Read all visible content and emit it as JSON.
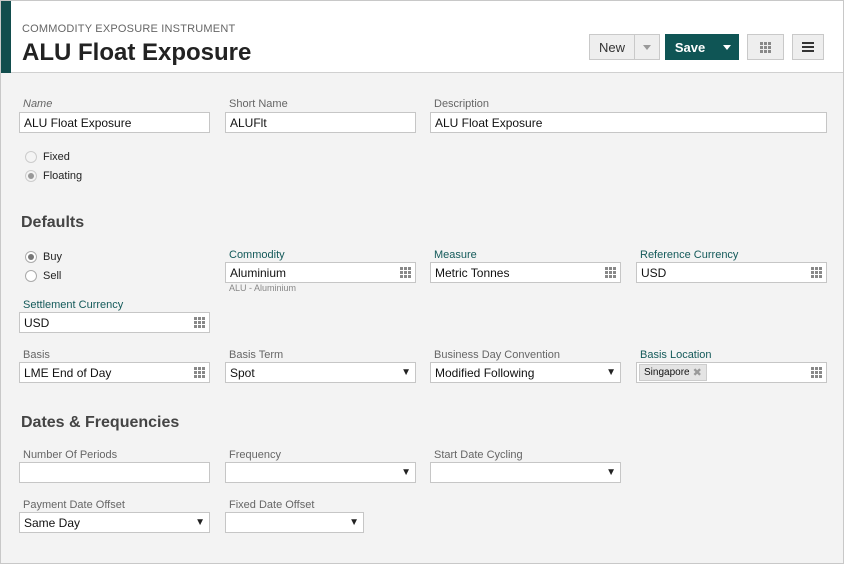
{
  "header": {
    "kicker": "COMMODITY EXPOSURE INSTRUMENT",
    "title": "ALU Float Exposure",
    "new_label": "New",
    "save_label": "Save"
  },
  "general": {
    "name_label": "Name",
    "name_value": "ALU Float Exposure",
    "short_name_label": "Short Name",
    "short_name_value": "ALUFlt",
    "description_label": "Description",
    "description_value": "ALU Float Exposure",
    "rate_type": {
      "options": [
        "Fixed",
        "Floating"
      ],
      "selected": "Floating"
    }
  },
  "defaults": {
    "title": "Defaults",
    "direction": {
      "options": [
        "Buy",
        "Sell"
      ],
      "selected": "Buy"
    },
    "commodity_label": "Commodity",
    "commodity_value": "Aluminium",
    "commodity_hint": "ALU - Aluminium",
    "measure_label": "Measure",
    "measure_value": "Metric Tonnes",
    "reference_currency_label": "Reference Currency",
    "reference_currency_value": "USD",
    "settlement_currency_label": "Settlement Currency",
    "settlement_currency_value": "USD",
    "basis_label": "Basis",
    "basis_value": "LME End of Day",
    "basis_term_label": "Basis Term",
    "basis_term_value": "Spot",
    "business_day_label": "Business Day Convention",
    "business_day_value": "Modified Following",
    "basis_location_label": "Basis Location",
    "basis_location_chip": "Singapore"
  },
  "dates": {
    "title": "Dates & Frequencies",
    "number_of_periods_label": "Number Of Periods",
    "number_of_periods_value": "",
    "frequency_label": "Frequency",
    "frequency_value": "",
    "start_date_cycling_label": "Start Date Cycling",
    "start_date_cycling_value": "",
    "payment_date_offset_label": "Payment Date Offset",
    "payment_date_offset_value": "Same Day",
    "fixed_date_offset_label": "Fixed Date Offset",
    "fixed_date_offset_value": ""
  },
  "colors": {
    "accent": "#124d4d",
    "save_button": "#0f5555",
    "section_label": "#145a5a"
  }
}
